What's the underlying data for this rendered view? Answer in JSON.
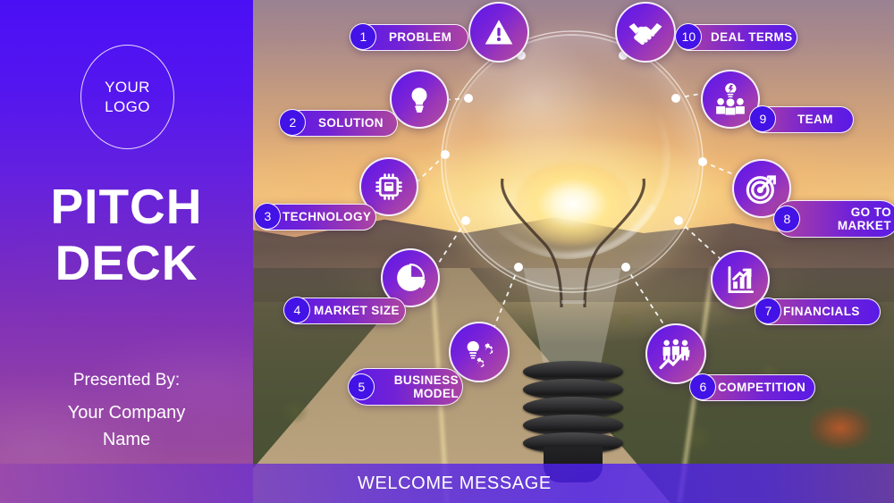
{
  "slide": {
    "title_line1": "PITCH",
    "title_line2": "DECK",
    "logo_line1": "YOUR",
    "logo_line2": "LOGO",
    "presented_label": "Presented By:",
    "company_name": "Your Company\nName",
    "footer_message": "WELCOME MESSAGE",
    "colors": {
      "panel_top": "#4B0FF5",
      "panel_bottom": "#A0589D",
      "pill_violet": "#5A1AE6",
      "pill_magenta": "#AB44A2",
      "badge_blue": "#4312E6",
      "outline_white": "#FFFFFF"
    }
  },
  "items": [
    {
      "number": "1",
      "label": "PROBLEM",
      "icon": "warning-triangle-icon"
    },
    {
      "number": "2",
      "label": "SOLUTION",
      "icon": "lightbulb-icon"
    },
    {
      "number": "3",
      "label": "TECHNOLOGY",
      "icon": "microchip-icon"
    },
    {
      "number": "4",
      "label": "MARKET SIZE",
      "icon": "pie-chart-icon"
    },
    {
      "number": "5",
      "label": "BUSINESS\nMODEL",
      "icon": "lightbulb-gears-icon"
    },
    {
      "number": "6",
      "label": "COMPETITION",
      "icon": "people-growth-icon"
    },
    {
      "number": "7",
      "label": "FINANCIALS",
      "icon": "bar-chart-arrow-icon"
    },
    {
      "number": "8",
      "label": "GO TO\nMARKET",
      "icon": "target-arrow-icon"
    },
    {
      "number": "9",
      "label": "TEAM",
      "icon": "team-bulb-icon"
    },
    {
      "number": "10",
      "label": "DEAL TERMS",
      "icon": "handshake-icon"
    }
  ]
}
